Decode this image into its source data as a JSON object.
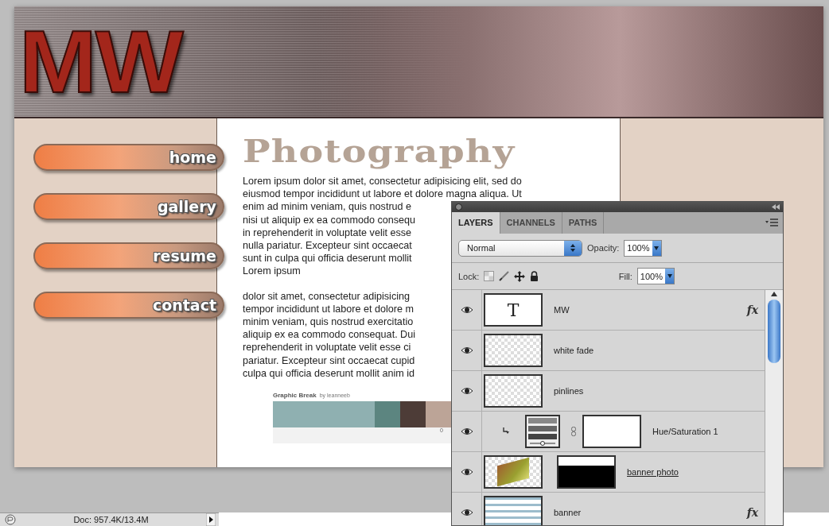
{
  "banner": {
    "logo": "MW"
  },
  "nav": [
    {
      "label": "home"
    },
    {
      "label": "gallery"
    },
    {
      "label": "resume"
    },
    {
      "label": "contact"
    }
  ],
  "content": {
    "title": "Photography",
    "paragraphs": [
      [
        "Lorem ipsum dolor sit amet, consectetur adipisicing elit, sed do",
        "eiusmod tempor incididunt ut labore et dolore magna aliqua. Ut",
        "enim ad minim veniam, quis nostrud e",
        "nisi ut aliquip ex ea commodo consequ",
        "in reprehenderit in voluptate velit esse",
        "nulla pariatur. Excepteur sint occaecat",
        "sunt in culpa qui officia deserunt mollit",
        "Lorem ipsum"
      ],
      [
        "dolor sit amet, consectetur adipisicing",
        "tempor incididunt ut labore et dolore m",
        "minim veniam, quis nostrud exercitatio",
        "aliquip ex ea commodo consequat. Dui",
        "reprehenderit in voluptate velit esse ci",
        "pariatur. Excepteur sint occaecat cupid",
        "culpa qui officia deserunt mollit anim id"
      ]
    ],
    "graphic_break": {
      "title": "Graphic Break",
      "byline": "by leanneeb",
      "caption": "0",
      "swatches": [
        {
          "color": "#8fb0b1",
          "kind": "wide"
        },
        {
          "color": "#5c8580",
          "kind": "narrow"
        },
        {
          "color": "#4d3c37",
          "kind": "narrow"
        },
        {
          "color": "#bca497",
          "kind": "narrow"
        }
      ]
    }
  },
  "layers_panel": {
    "tabs": [
      {
        "label": "LAYERS",
        "selected": true
      },
      {
        "label": "CHANNELS",
        "selected": false
      },
      {
        "label": "PATHS",
        "selected": false
      }
    ],
    "blend_mode": "Normal",
    "opacity_label": "Opacity:",
    "opacity": "100%",
    "lock_label": "Lock:",
    "fill_label": "Fill:",
    "fill": "100%",
    "layers": [
      {
        "name": "MW",
        "kind": "text",
        "thumb_label": "T",
        "visible": true,
        "fx": "fx"
      },
      {
        "name": "white fade",
        "kind": "transparent",
        "visible": true
      },
      {
        "name": "pinlines",
        "kind": "transparent",
        "visible": true
      },
      {
        "name": "Hue/Saturation 1",
        "kind": "adjustment",
        "mask": {
          "kind": "white"
        },
        "visible": true,
        "clipped": true
      },
      {
        "name": "banner photo",
        "kind": "photo",
        "mask": {
          "kind": "black"
        },
        "visible": true,
        "underlined": true
      },
      {
        "name": "banner",
        "kind": "fill",
        "visible": true,
        "fx": "fx"
      }
    ]
  },
  "status_bar": {
    "doc": "Doc: 957.4K/13.4M"
  }
}
